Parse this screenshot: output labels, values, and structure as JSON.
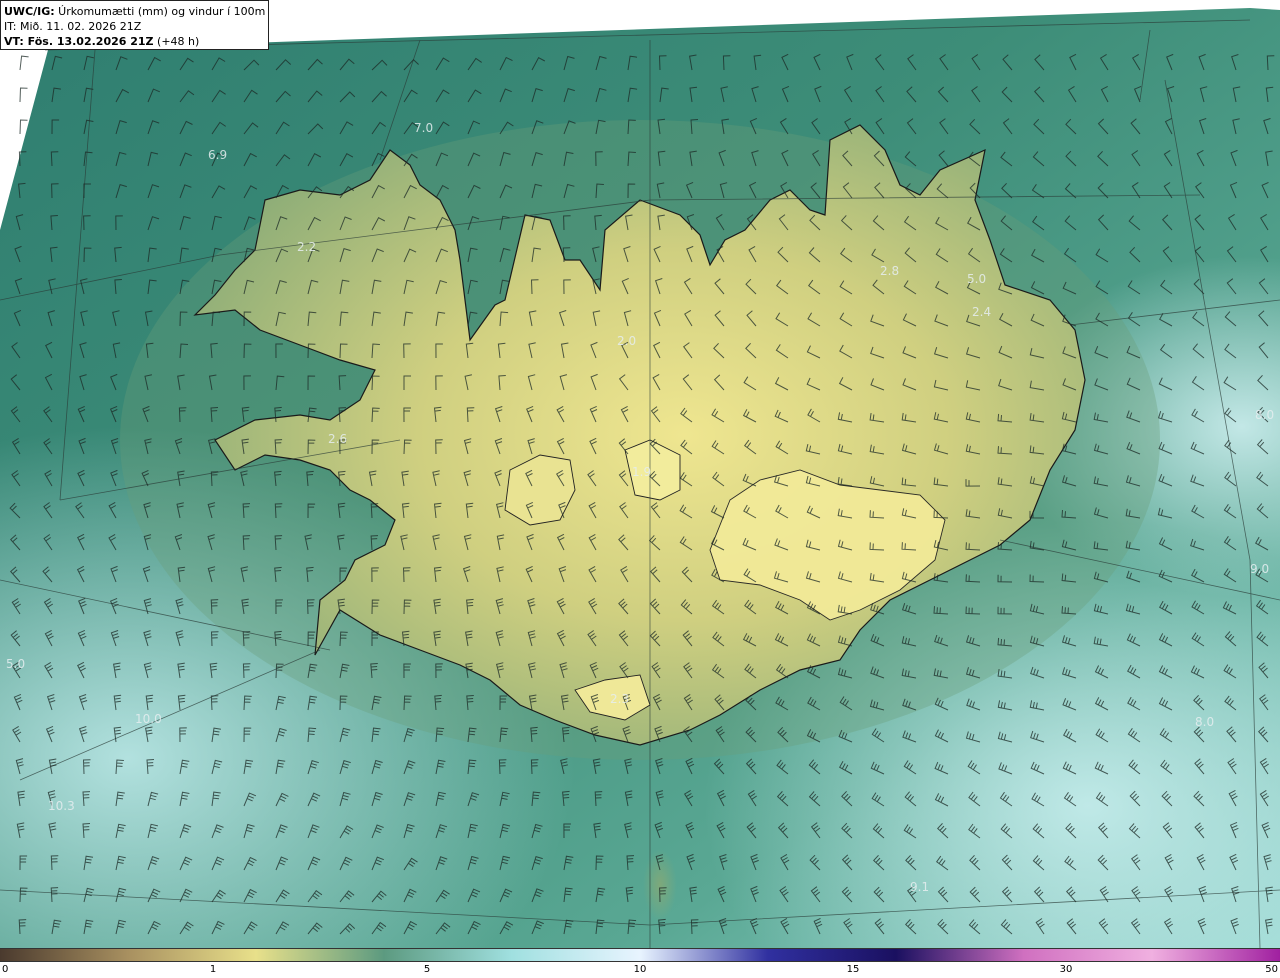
{
  "header": {
    "product_code": "UWC/IG:",
    "product_desc": " Úrkomumætti (mm) og vindur í 100m hæð",
    "init_time": "IT: Mið. 11. 02. 2026 21Z",
    "valid_prefix": "VT: Fös. 13.02.2026 21Z",
    "valid_suffix": " (+48 h)"
  },
  "colorbar": {
    "ticks": [
      "0",
      "1",
      "5",
      "10",
      "15",
      "30",
      "50"
    ],
    "stops": [
      "#4a3a2e",
      "#a89060",
      "#e8e08a",
      "#5c9a80",
      "#a0e0e0",
      "#e8f4ff",
      "#3030a0",
      "#1a1060",
      "#d070c0",
      "#f0b0e0",
      "#a020a0"
    ]
  },
  "contour_labels": [
    "7.0",
    "6.9",
    "2.2",
    "2.8",
    "5.0",
    "2.4",
    "2.0",
    "2.6",
    "1.9",
    "5.0",
    "10.0",
    "10.3",
    "8.0",
    "2.3",
    "8.0",
    "9.1",
    "9.0"
  ],
  "colors": {
    "land_low": "#e8e08a",
    "land_mid": "#b8b878",
    "sea_mid": "#3a8a78",
    "sea_high": "#a8e0dc",
    "coast": "#1a1a1a"
  }
}
